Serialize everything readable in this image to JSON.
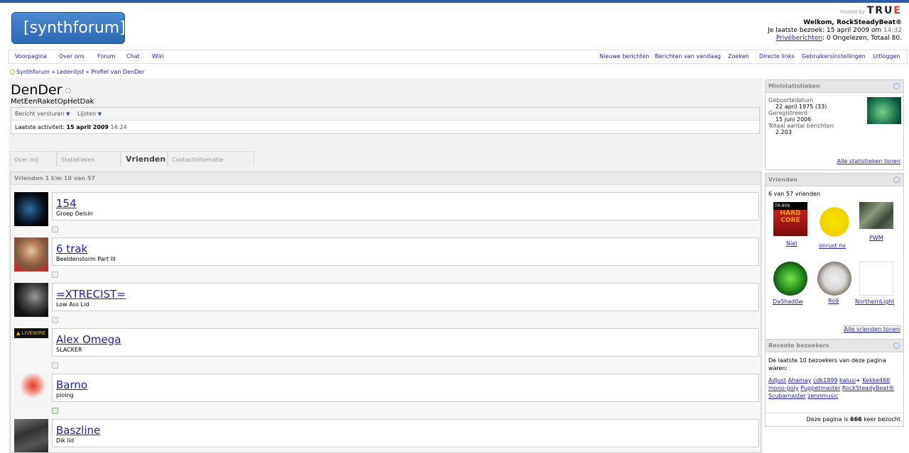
{
  "site": {
    "logo_text": "[synthforum]",
    "hosted_by": "hosted by",
    "hosted_brand": "TRU",
    "hosted_brand_accent": "E",
    "welcome": "Welkom, RockSteadyBeat®",
    "last_visit_text": "Je laatste bezoek: 15 april 2009 om",
    "last_visit_time": "14:32",
    "pm_link": "Privéberichten",
    "pm_text": ": 0 Ongelezen, Totaal 80."
  },
  "nav": {
    "left": [
      "Voorpagina",
      "Over ons",
      "Forum",
      "Chat",
      "Wiki"
    ],
    "right": [
      "Nieuwe berichten",
      "Berichten van vandaag",
      "Zoeken",
      "Directe links",
      "Gebruikersinstellingen",
      "Uitloggen"
    ]
  },
  "breadcrumb": "Synthforum » Ledenlijst » Profiel van DenDer",
  "profile": {
    "username": "DenDer",
    "usertitle": "MetEenRaketOpHetDak",
    "action_send": "Bericht versturen",
    "action_lists": "Lijsten",
    "last_activity_label": "Laatste activiteit:",
    "last_activity_date": "15 april 2009",
    "last_activity_time": "14:24"
  },
  "tabs": [
    "Over mij",
    "Statistieken",
    "Vrienden",
    "Contactinformatie"
  ],
  "friends": {
    "header": "Vrienden 1 t/m 10 van 57",
    "items": [
      {
        "name": "154",
        "sub": "Groep Delsin"
      },
      {
        "name": "6 trak",
        "sub": "Beeldenstorm Part III"
      },
      {
        "name": "=XTRECIST=",
        "sub": "Low Ass Lid"
      },
      {
        "name": "Alex Omega",
        "sub": "SLACKER"
      },
      {
        "name": "Barno",
        "sub": "ploing"
      },
      {
        "name": "Baszline",
        "sub": "Dik lid"
      }
    ]
  },
  "sidebar": {
    "ministats": {
      "title": "Ministatistieken",
      "birth_label": "Geboortedatum",
      "birth_value": "22 april 1975 (33)",
      "reg_label": "Geregistreerd",
      "reg_value": "15 juni 2006",
      "posts_label": "Totaal aantal berichten",
      "posts_value": "2.203",
      "link": "Alle statistieken tonen"
    },
    "friends": {
      "title": "Vrienden",
      "count_text": "6 van 57 vrienden",
      "names": [
        "Niel",
        "onrust nv",
        "PWM",
        "DaShad0w",
        "Ro9",
        "NorthernLight"
      ],
      "link": "Alle vrienden tonen"
    },
    "visitors": {
      "title": "Recente bezoekers",
      "intro": "De laatste 10 bezoekers van deze pagina waren:",
      "names": [
        "Adjust",
        "Ahamay",
        "cdk1899",
        "kalusi",
        "Kekke466",
        "mono-poly",
        "Puppetmaster",
        "RockSteadyBeat®",
        "Scubamaster",
        "zennmusic"
      ],
      "plus": "+",
      "views_pre": "Deze pagina is",
      "views_count": "666",
      "views_post": "keer bezocht"
    }
  }
}
